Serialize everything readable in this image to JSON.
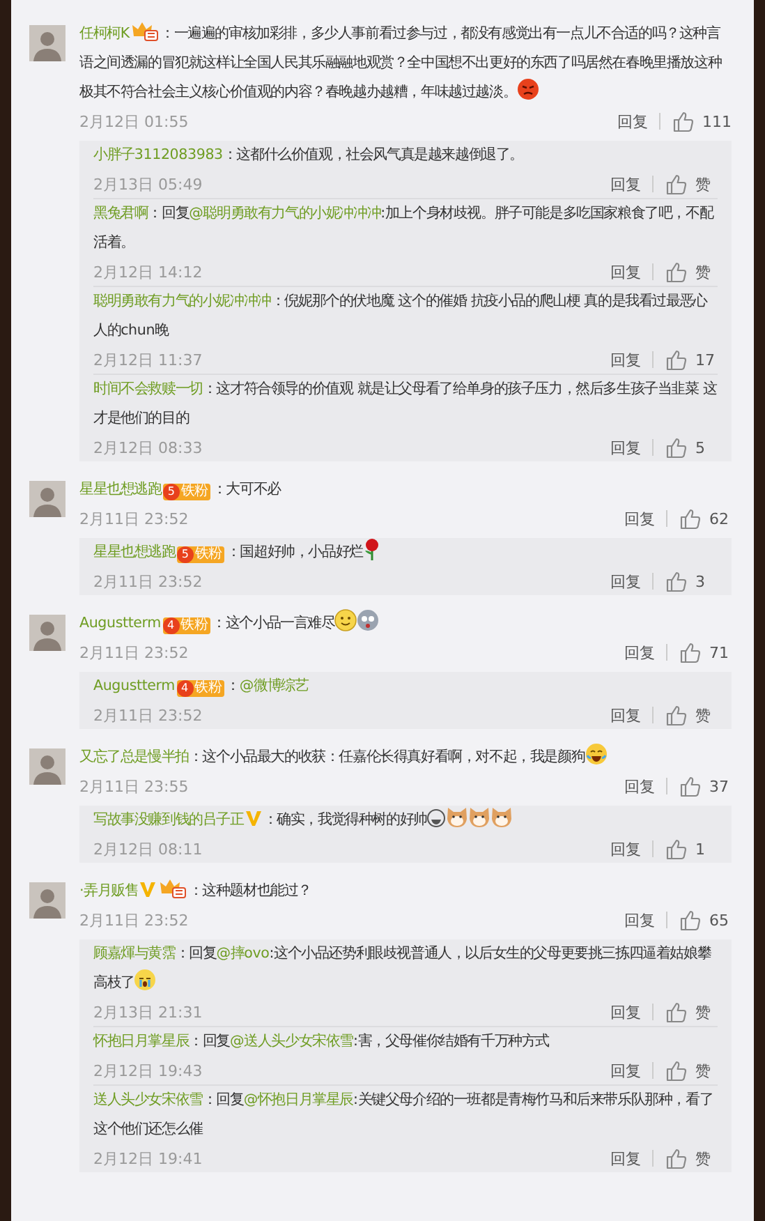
{
  "comments": [
    {
      "user": "任柯柯K",
      "badges": [
        {
          "kind": "crown"
        }
      ],
      "segments": [
        {
          "kind": "text",
          "text": "：一遍遍的审核加彩排，多少人事前看过参与过，都没有感觉出有一点儿不合适的吗？这种言语之间透漏的冒犯就这样让全国人民其乐融融地观赏？全中国想不出更好的东西了吗居然在春晚里播放这种极其不符合社会主义核心价值观的内容？春晚越办越糟，年味越过越淡。"
        },
        {
          "kind": "angry-emoji"
        }
      ],
      "time": "2月12日 01:55",
      "reply_label": "回复",
      "likes": "111",
      "replies": [
        {
          "user": "小胖子3112083983",
          "segments": [
            {
              "kind": "text",
              "text": "：这都什么价值观，社会风气真是越来越倒退了。"
            }
          ],
          "time": "2月13日 05:49",
          "reply_label": "回复",
          "likes": "赞"
        },
        {
          "user": "黑兔君啊",
          "segments": [
            {
              "kind": "text",
              "text": "：回复"
            },
            {
              "kind": "mention",
              "text": "@聪明勇敢有力气的小妮冲冲冲"
            },
            {
              "kind": "text",
              "text": ":加上个身材歧视。胖子可能是多吃国家粮食了吧，不配活着。"
            }
          ],
          "time": "2月12日 14:12",
          "reply_label": "回复",
          "likes": "赞"
        },
        {
          "user": "聪明勇敢有力气的小妮冲冲冲",
          "segments": [
            {
              "kind": "text",
              "text": "：倪妮那个的伏地魔 这个的催婚 抗疫小品的爬山梗 真的是我看过最恶心人的chun晚"
            }
          ],
          "time": "2月12日 11:37",
          "reply_label": "回复",
          "likes": "17"
        },
        {
          "user": "时间不会救赎一切",
          "segments": [
            {
              "kind": "text",
              "text": "：这才符合领导的价值观 就是让父母看了给单身的孩子压力，然后多生孩子当韭菜 这才是他们的目的"
            }
          ],
          "time": "2月12日 08:33",
          "reply_label": "回复",
          "likes": "5"
        }
      ]
    },
    {
      "user": "星星也想逃跑",
      "badges": [
        {
          "kind": "fan",
          "level": "5",
          "label": "铁粉"
        }
      ],
      "segments": [
        {
          "kind": "text",
          "text": "：大可不必"
        }
      ],
      "time": "2月11日 23:52",
      "reply_label": "回复",
      "likes": "62",
      "replies": [
        {
          "user": "星星也想逃跑",
          "badges": [
            {
              "kind": "fan",
              "level": "5",
              "label": "铁粉"
            }
          ],
          "segments": [
            {
              "kind": "text",
              "text": "：国超好帅，小品好烂"
            },
            {
              "kind": "rose-emoji"
            }
          ],
          "time": "2月11日 23:52",
          "reply_label": "回复",
          "likes": "3"
        }
      ]
    },
    {
      "user": "Augustterm",
      "badges": [
        {
          "kind": "fan",
          "level": "4",
          "label": "铁粉"
        }
      ],
      "segments": [
        {
          "kind": "text",
          "text": "：这个小品一言难尽"
        },
        {
          "kind": "smile-emoji"
        },
        {
          "kind": "gray-face-emoji"
        }
      ],
      "time": "2月11日 23:52",
      "reply_label": "回复",
      "likes": "71",
      "replies": [
        {
          "user": "Augustterm",
          "badges": [
            {
              "kind": "fan",
              "level": "4",
              "label": "铁粉"
            }
          ],
          "segments": [
            {
              "kind": "text",
              "text": "："
            },
            {
              "kind": "mention",
              "text": "@微博综艺"
            }
          ],
          "time": "2月11日 23:52",
          "reply_label": "回复",
          "likes": "赞"
        }
      ]
    },
    {
      "user": "又忘了总是慢半拍",
      "segments": [
        {
          "kind": "text",
          "text": "：这个小品最大的收获：任嘉伦长得真好看啊，对不起，我是颜狗"
        },
        {
          "kind": "laugh-emoji"
        }
      ],
      "time": "2月11日 23:55",
      "reply_label": "回复",
      "likes": "37",
      "replies": [
        {
          "user": "写故事没赚到钱的吕子正",
          "badges": [
            {
              "kind": "verified"
            }
          ],
          "segments": [
            {
              "kind": "text",
              "text": "：确实，我觉得种树的好帅"
            },
            {
              "kind": "grin-emoji"
            },
            {
              "kind": "cat-emoji"
            },
            {
              "kind": "cat-emoji"
            },
            {
              "kind": "cat-emoji"
            }
          ],
          "time": "2月12日 08:11",
          "reply_label": "回复",
          "likes": "1"
        }
      ]
    },
    {
      "user": "·弄月贩售",
      "badges": [
        {
          "kind": "verified"
        },
        {
          "kind": "crown"
        }
      ],
      "segments": [
        {
          "kind": "text",
          "text": "：这种题材也能过？"
        }
      ],
      "time": "2月11日 23:52",
      "reply_label": "回复",
      "likes": "65",
      "replies": [
        {
          "user": "顾嘉煇与黄霑",
          "segments": [
            {
              "kind": "text",
              "text": "：回复"
            },
            {
              "kind": "mention",
              "text": "@摔ovo"
            },
            {
              "kind": "text",
              "text": ":这个小品还势利眼歧视普通人，以后女生的父母更要挑三拣四逼着姑娘攀高枝了"
            },
            {
              "kind": "cry-emoji"
            }
          ],
          "time": "2月13日 21:31",
          "reply_label": "回复",
          "likes": "赞"
        },
        {
          "user": "怀抱日月掌星辰",
          "segments": [
            {
              "kind": "text",
              "text": "：回复"
            },
            {
              "kind": "mention",
              "text": "@送人头少女宋依雪"
            },
            {
              "kind": "text",
              "text": ":害，父母催你结婚有千万种方式"
            }
          ],
          "time": "2月12日 19:43",
          "reply_label": "回复",
          "likes": "赞"
        },
        {
          "user": "送人头少女宋依雪",
          "segments": [
            {
              "kind": "text",
              "text": "：回复"
            },
            {
              "kind": "mention",
              "text": "@怀抱日月掌星辰"
            },
            {
              "kind": "text",
              "text": ":关键父母介绍的一班都是青梅竹马和后来带乐队那种，看了这个他们还怎么催"
            }
          ],
          "time": "2月12日 19:41",
          "reply_label": "回复",
          "likes": "赞"
        }
      ]
    }
  ]
}
